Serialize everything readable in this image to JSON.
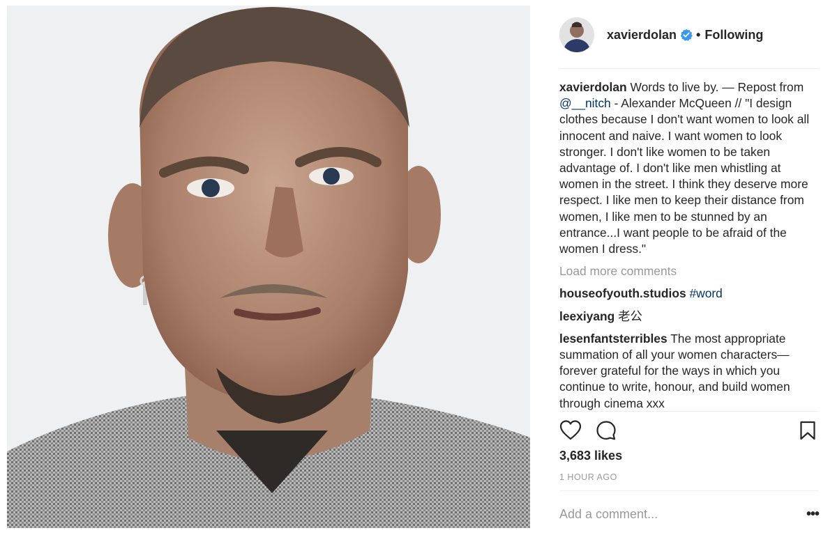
{
  "post": {
    "author": "xavierdolan",
    "follow_status": "Following",
    "separator": "•",
    "caption": {
      "username": "xavierdolan",
      "text_before": "Words to live by. — Repost from ",
      "mention": "@__nitch",
      "text_after": " - Alexander McQueen // \"I design clothes because I don't want women to look all innocent and naive. I want women to look stronger. I don't like women to be taken advantage of. I don't like men whistling at women in the street. I think they deserve more respect. I like men to keep their distance from women, I like men to be stunned by an entrance...I want people to be afraid of the women I dress.\""
    },
    "load_more": "Load more comments",
    "comments": [
      {
        "username": "houseofyouth.studios",
        "text": "",
        "hashtag": "#word"
      },
      {
        "username": "leexiyang",
        "text": "老公"
      },
      {
        "username": "lesenfantsterribles",
        "text": "The most appropriate summation of all your women characters—forever grateful for the ways in which you continue to write, honour, and build women through cinema xxx"
      }
    ],
    "likes": "3,683 likes",
    "time": "1 HOUR AGO",
    "add_comment_placeholder": "Add a comment...",
    "more_glyph": "•••"
  },
  "icons": {
    "verified": "verified-badge-icon",
    "like": "heart-icon",
    "comment": "comment-bubble-icon",
    "save": "bookmark-icon",
    "more": "more-options-icon"
  },
  "colors": {
    "link": "#003569",
    "muted": "#999999",
    "text": "#262626",
    "verified": "#3897f0"
  }
}
